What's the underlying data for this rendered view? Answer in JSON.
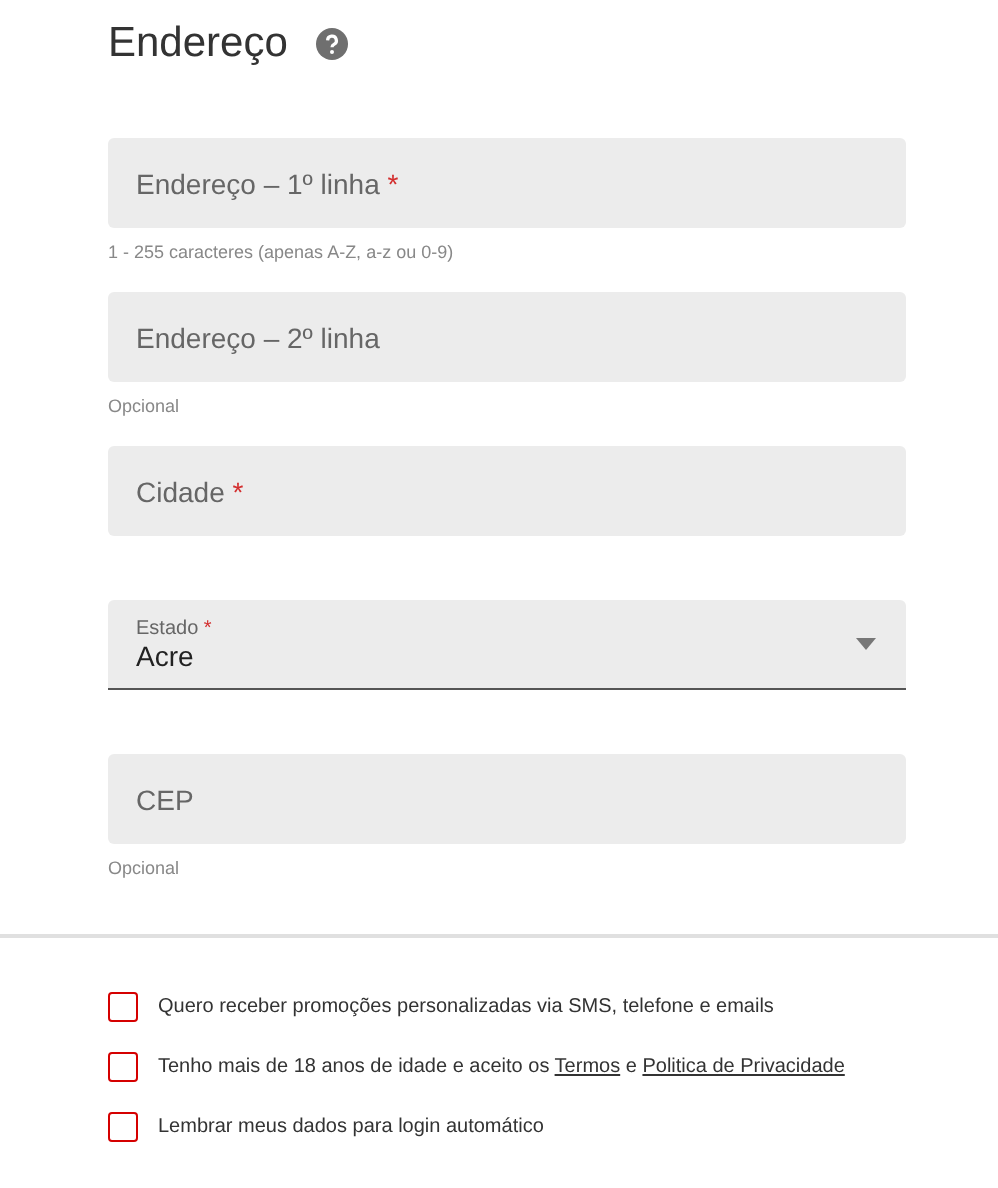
{
  "title": "Endereço",
  "fields": [
    {
      "kind": "text",
      "label": "Endereço – 1º linha",
      "required_mark": "*",
      "helper": "1 - 255 caracteres (apenas A-Z, a-z ou 0-9)"
    },
    {
      "kind": "text",
      "label": "Endereço – 2º linha",
      "helper": "Opcional"
    },
    {
      "kind": "text",
      "label": "Cidade",
      "required_mark": "*"
    },
    {
      "kind": "select",
      "label": "Estado",
      "required_mark": "*",
      "value": "Acre"
    },
    {
      "kind": "text",
      "label": "CEP",
      "helper": "Opcional"
    }
  ],
  "checkboxes": [
    {
      "checked": false,
      "parts": [
        {
          "text": "Quero receber promoções personalizadas via SMS, telefone e emails",
          "link": false
        }
      ]
    },
    {
      "checked": false,
      "parts": [
        {
          "text": "Tenho mais de 18 anos de idade e aceito os ",
          "link": false
        },
        {
          "text": "Termos",
          "link": true
        },
        {
          "text": " e ",
          "link": false
        },
        {
          "text": "Politica de Privacidade",
          "link": true
        }
      ]
    },
    {
      "checked": false,
      "parts": [
        {
          "text": "Lembrar meus dados para login automático",
          "link": false
        }
      ]
    }
  ]
}
